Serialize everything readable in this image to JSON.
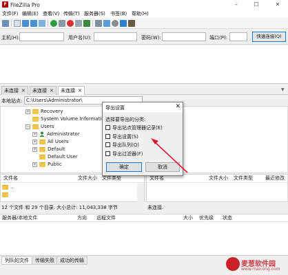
{
  "window": {
    "title": "FileZilla Pro",
    "icon_letter": "F",
    "minimize": "–",
    "maximize": "☐",
    "close": "✕"
  },
  "menu": [
    "文件(F)",
    "编辑(E)",
    "查看(V)",
    "传输(T)",
    "服务器(S)",
    "书签(B)",
    "帮助(H)"
  ],
  "quickconnect": {
    "host_label": "主机(H):",
    "user_label": "用户名(U):",
    "pass_label": "密码(W):",
    "port_label": "端口(P):",
    "host_value": "",
    "user_value": "",
    "pass_value": "",
    "port_value": "",
    "button": "快速连接(Q)"
  },
  "connection_tabs": [
    {
      "label": "未连接",
      "close": "✕"
    },
    {
      "label": "未连接",
      "close": "✕"
    },
    {
      "label": "未连接",
      "close": "✕"
    }
  ],
  "local": {
    "site_label": "本地站点:",
    "site_path": "C:\\Users\\Administrator\\",
    "tree": {
      "recovery": "Recovery",
      "svi": "System Volume Information",
      "users": "Users",
      "administrator": "Administrator",
      "all_users": "All Users",
      "default": "Default",
      "default_user": "Default User",
      "public": "Public"
    },
    "columns": {
      "name": "文件名",
      "size": "文件大小",
      "type": "文件类型"
    },
    "rows": [
      ".."
    ],
    "status": "12 个文件 和 29 个目录. 大小总计: 11,043,338 字节"
  },
  "remote": {
    "columns": {
      "name": "文件名",
      "size": "文件大小",
      "type": "文件类型",
      "modified": "最近修改"
    },
    "status": "未连接."
  },
  "queue": {
    "columns": {
      "server": "服务器/本地文件",
      "direction": "方向",
      "remote": "远程文件",
      "size": "大小",
      "priority": "优先级",
      "status": "状态"
    },
    "tabs": [
      "列队的文件",
      "传输失败",
      "成功的传输"
    ]
  },
  "dialog": {
    "title": "导出设置",
    "close": "✕",
    "prompt": "选择要导出的分类:",
    "options": [
      {
        "label": "导出站点管理器记录(E)",
        "checked": false
      },
      {
        "label": "导出设置(S)",
        "checked": false
      },
      {
        "label": "导出队列(Q)",
        "checked": false
      },
      {
        "label": "导出过滤器(F)",
        "checked": false
      }
    ],
    "ok": "确定",
    "cancel": "取消"
  },
  "watermark": {
    "text": "麦葱软件园",
    "url": "www.maicong.com"
  },
  "colors": {
    "accent": "#0078d7",
    "arrow": "#d7162a",
    "folder": "#f2c64e",
    "watermark": "#c9222b"
  }
}
